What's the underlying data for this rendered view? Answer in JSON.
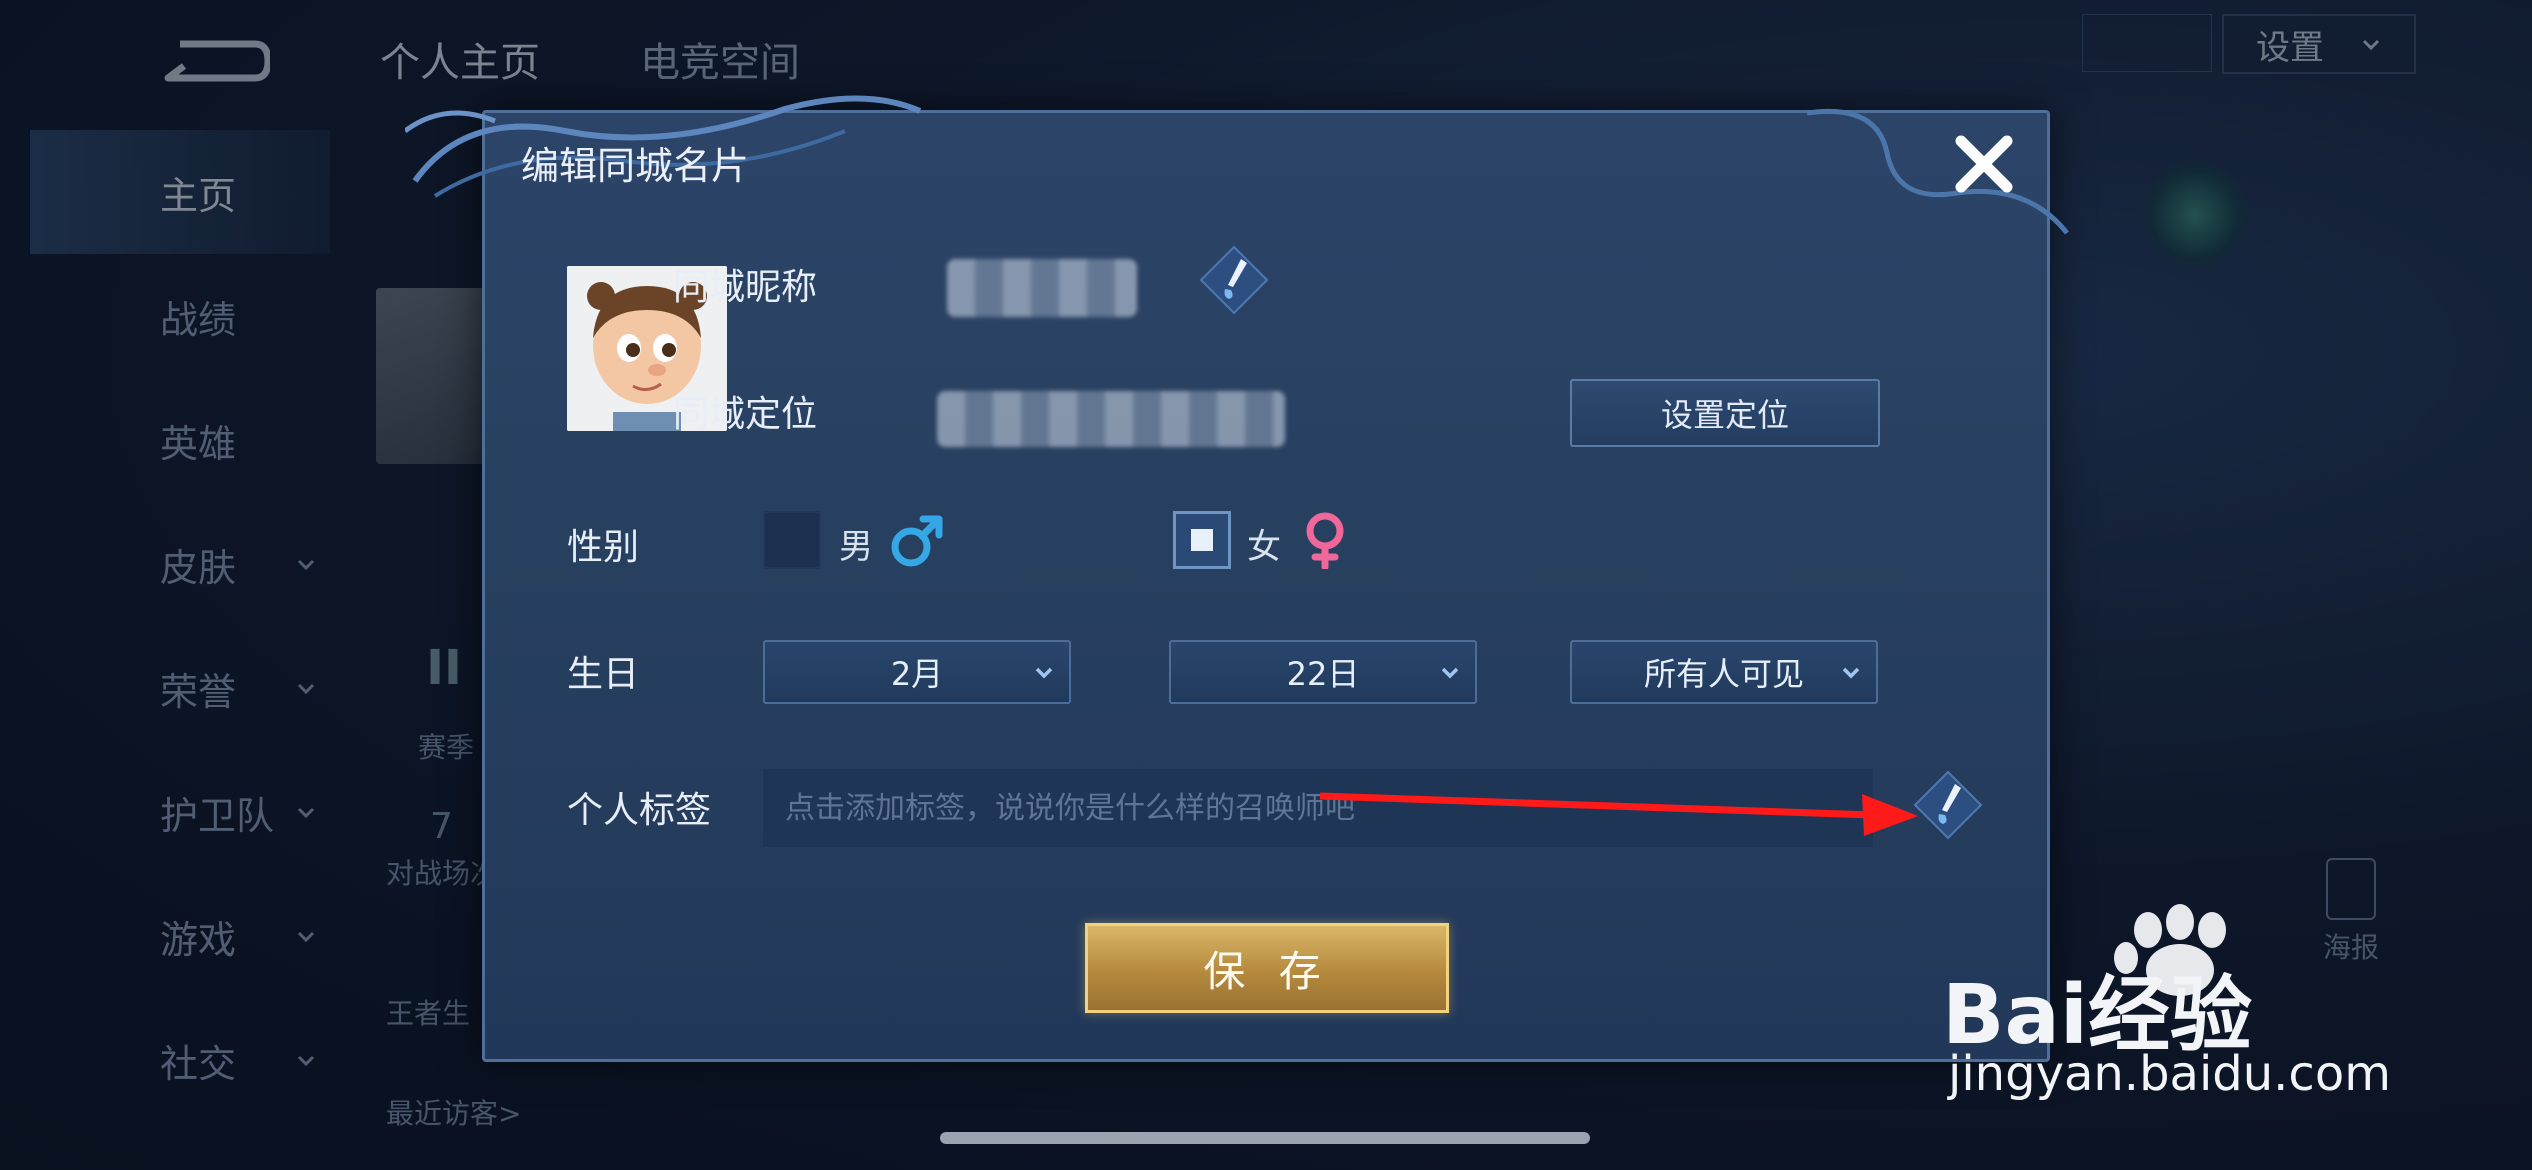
{
  "background": {
    "tabs": [
      {
        "label": "个人主页",
        "active": true
      },
      {
        "label": "电竞空间",
        "active": false
      }
    ],
    "sidebar": [
      {
        "label": "主页",
        "active": true,
        "has_chevron": false
      },
      {
        "label": "战绩",
        "active": false,
        "has_chevron": false
      },
      {
        "label": "英雄",
        "active": false,
        "has_chevron": false
      },
      {
        "label": "皮肤",
        "active": false,
        "has_chevron": true
      },
      {
        "label": "荣誉",
        "active": false,
        "has_chevron": true
      },
      {
        "label": "护卫队",
        "active": false,
        "has_chevron": true
      },
      {
        "label": "游戏",
        "active": false,
        "has_chevron": true
      },
      {
        "label": "社交",
        "active": false,
        "has_chevron": true
      }
    ],
    "settings_label": "设置",
    "season_label": "赛季",
    "battle_count": "7",
    "battle_label": "对战场次",
    "king_label": "王者生",
    "recent_visitors": "最近访客>",
    "poster_label": "海报"
  },
  "modal": {
    "title": "编辑同城名片",
    "nickname_label": "同城昵称",
    "location_label": "同城定位",
    "set_location_button": "设置定位",
    "gender_label": "性别",
    "gender_male": "男",
    "gender_female": "女",
    "gender_selected": "女",
    "birthday_label": "生日",
    "birthday_month": "2月",
    "birthday_day": "22日",
    "visibility": "所有人可见",
    "tag_label": "个人标签",
    "tag_placeholder": "点击添加标签，说说你是什么样的召唤师吧",
    "save_button": "保 存"
  },
  "watermark": {
    "logo_text": "Bai经验",
    "url": "jingyan.baidu.com"
  },
  "colors": {
    "accent_blue": "#35a7e6",
    "female_pink": "#f0679a",
    "annotation_red": "#ff1a1a",
    "save_gold": "#c9a153"
  }
}
